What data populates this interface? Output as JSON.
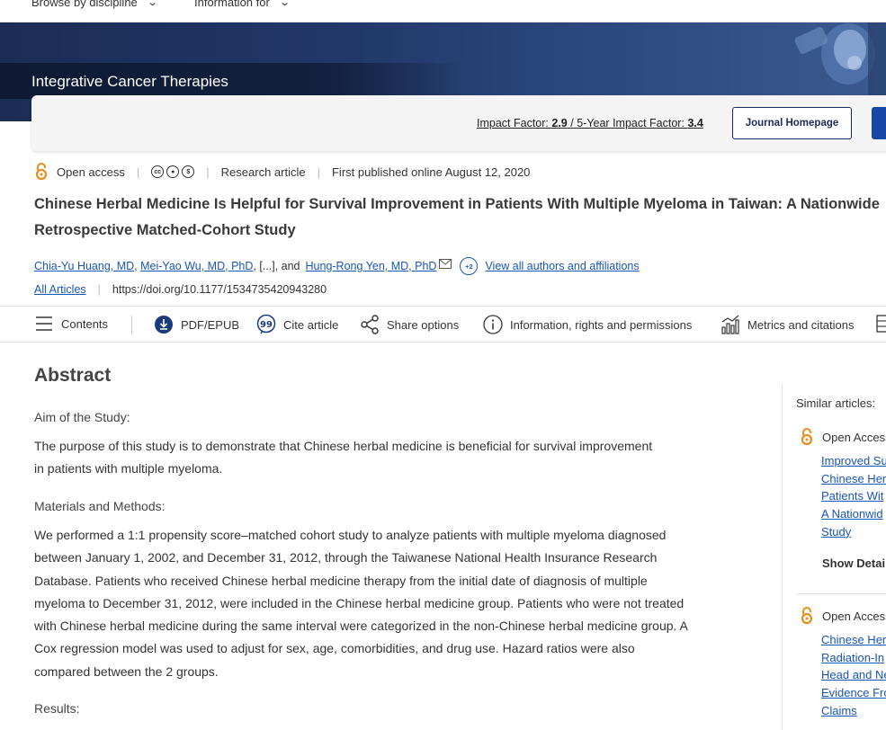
{
  "topnav": {
    "browse": "Browse by discipline",
    "info": "Information for"
  },
  "journal": {
    "title": "Integrative Cancer Therapies",
    "impact_label": "Impact Factor:",
    "impact_value": "2.9",
    "five_year_label": "5-Year Impact Factor:",
    "five_year_value": "3.4",
    "homepage_button": "Journal Homepage"
  },
  "meta": {
    "open_access": "Open access",
    "cc_icons": [
      "cc",
      "by",
      "nc"
    ],
    "article_type": "Research article",
    "published": "First published online August 12, 2020"
  },
  "article": {
    "title": "Chinese Herbal Medicine Is Helpful for Survival Improvement in Patients With Multiple Myeloma in Taiwan: A Nationwide Retrospective Matched-Cohort Study",
    "authors": [
      "Chia-Yu Huang, MD",
      "Mei-Yao Wu, MD, PhD",
      "Hung-Rong Yen, MD, PhD"
    ],
    "authors_ellipsis": ", [...], and",
    "more_authors": "+2",
    "view_all": "View all authors and affiliations",
    "all_articles": "All Articles",
    "doi": "https://doi.org/10.1177/1534735420943280"
  },
  "toolbar": {
    "contents": "Contents",
    "pdf": "PDF/EPUB",
    "cite": "Cite article",
    "share": "Share options",
    "info": "Information, rights and permissions",
    "metrics": "Metrics and citations"
  },
  "abstract": {
    "heading": "Abstract",
    "aim_heading": "Aim of the Study:",
    "aim_text": "The purpose of this study is to demonstrate that Chinese herbal medicine is beneficial for survival improvement in patients with multiple myeloma.",
    "methods_heading": "Materials and Methods:",
    "methods_text": "We performed a 1:1 propensity score–matched cohort study to analyze patients with multiple myeloma diagnosed between January 1, 2002, and December 31, 2012, through the Taiwanese National Health Insurance Research Database. Patients who received Chinese herbal medicine therapy from the initial date of diagnosis of multiple myeloma to December 31, 2012, were included in the Chinese herbal medicine group. Patients who were not treated with Chinese herbal medicine during the same interval were categorized in the non-Chinese herbal medicine group. A Cox regression model was used to adjust for sex, age, comorbidities, and drug use. Hazard ratios were also compared between the 2 groups.",
    "results_heading": "Results:"
  },
  "sidebar": {
    "heading": "Similar articles:",
    "items": [
      {
        "open_access": "Open Access",
        "title_lines": [
          "Improved Su",
          "Chinese Her",
          "Patients Wit",
          "A Nationwid",
          "Study"
        ],
        "show_details": "Show Detail"
      },
      {
        "open_access": "Open Access",
        "title_lines": [
          "Chinese Her",
          "Radiation-In",
          "Head and Ne",
          "Evidence Fro",
          "Claims"
        ]
      }
    ]
  }
}
